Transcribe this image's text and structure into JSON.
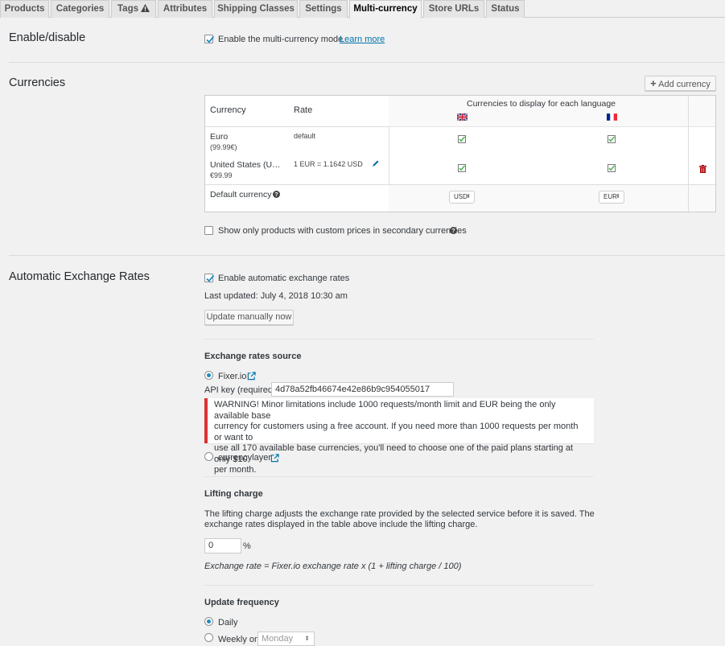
{
  "tabs": [
    {
      "label": "Products"
    },
    {
      "label": "Categories"
    },
    {
      "label": "Tags"
    },
    {
      "label": "Attributes"
    },
    {
      "label": "Shipping Classes"
    },
    {
      "label": "Settings"
    },
    {
      "label": "Multi-currency"
    },
    {
      "label": "Store URLs"
    },
    {
      "label": "Status"
    }
  ],
  "enable": {
    "title": "Enable/disable",
    "checkbox_label": "Enable the multi-currency mode",
    "learn_more": "Learn more"
  },
  "currencies": {
    "title": "Currencies",
    "add_button": "Add currency",
    "col_currency": "Currency",
    "col_rate": "Rate",
    "col_languages": "Currencies to display for each language",
    "rows": [
      {
        "name": "Euro",
        "sub": "(99.99€)",
        "rate": "default"
      },
      {
        "name": "United States (U…",
        "sub": "€99.99",
        "rate": "1 EUR = 1.1642 USD"
      }
    ],
    "default_label": "Default currency",
    "default_en": "USD",
    "default_fr": "EUR",
    "show_only_label": "Show only products with custom prices in secondary currencies"
  },
  "auto": {
    "title": "Automatic Exchange Rates",
    "enable_label": "Enable automatic exchange rates",
    "last_updated": "Last updated: July 4, 2018 10:30 am",
    "update_button": "Update manually now",
    "source_heading": "Exchange rates source",
    "source_fixer": "Fixer.io",
    "api_key_label": "API key (required)",
    "api_key_value": "4d78a52fb46674e42e86b9c954055017",
    "warning_lines": [
      "WARNING! Minor limitations include 1000 requests/month limit and EUR being the only available base",
      "currency for customers using a free account. If you need more than 1000 requests per month or want to",
      "use all 170 available base currencies, you'll need to choose one of the paid plans starting at only $10",
      "per month."
    ],
    "source_currencylayer": "currencylayer",
    "lifting_heading": "Lifting charge",
    "lifting_desc_1": "The lifting charge adjusts the exchange rate provided by the selected service before it is saved. The",
    "lifting_desc_2": "exchange rates displayed in the table above include the lifting charge.",
    "lifting_value": "0",
    "percent": "%",
    "formula": "Exchange rate = Fixer.io exchange rate x (1 + lifting charge / 100)",
    "frequency_heading": "Update frequency",
    "freq_daily": "Daily",
    "freq_weekly": "Weekly on",
    "weekday": "Monday"
  },
  "colors": {
    "link": "#0073aa",
    "check": "#1e8cbe",
    "tick_green": "#46b450",
    "warning_red": "#dc3232",
    "trash_red": "#a00"
  }
}
